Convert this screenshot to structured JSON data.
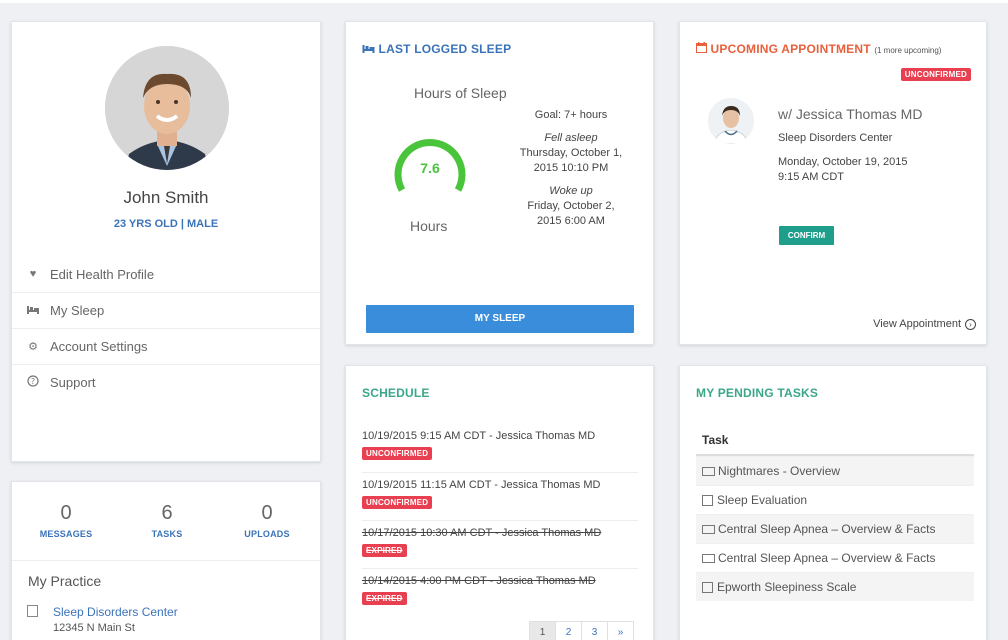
{
  "profile": {
    "name": "John Smith",
    "meta": "23 YRS OLD | MALE",
    "menu": [
      "Edit Health Profile",
      "My Sleep",
      "Account Settings",
      "Support"
    ]
  },
  "stats": [
    {
      "num": "0",
      "label": "MESSAGES"
    },
    {
      "num": "6",
      "label": "TASKS"
    },
    {
      "num": "0",
      "label": "UPLOADS"
    }
  ],
  "practice": {
    "title": "My Practice",
    "name": "Sleep Disorders Center",
    "address": "12345 N Main St"
  },
  "last_sleep": {
    "title": "LAST LOGGED SLEEP",
    "hours_title": "Hours of Sleep",
    "value": "7.6",
    "value_num": 7.6,
    "unit": "Hours",
    "goal": "Goal: 7+ hours",
    "fell_label": "Fell asleep",
    "fell_date": "Thursday, October 1,",
    "fell_time": "2015 10:10 PM",
    "woke_label": "Woke up",
    "woke_date": "Friday, October 2,",
    "woke_time": "2015 6:00 AM",
    "button": "MY SLEEP"
  },
  "appointment": {
    "title": "UPCOMING APPOINTMENT",
    "more": "(1 more upcoming)",
    "status": "UNCONFIRMED",
    "with": "w/ Jessica Thomas MD",
    "center": "Sleep Disorders Center",
    "date": "Monday, October 19, 2015",
    "time": "9:15 AM CDT",
    "confirm": "CONFIRM",
    "view": "View Appointment"
  },
  "schedule": {
    "title": "SCHEDULE",
    "rows": [
      {
        "text": "10/19/2015 9:15 AM CDT - Jessica Thomas MD",
        "badge": "UNCONFIRMED"
      },
      {
        "text": "10/19/2015 11:15 AM CDT - Jessica Thomas MD",
        "badge": "UNCONFIRMED"
      },
      {
        "text": "10/17/2015 10:30 AM CDT - Jessica Thomas MD",
        "badge": "EXPIRED"
      },
      {
        "text": "10/14/2015 4:00 PM CDT - Jessica Thomas MD",
        "badge": "EXPIRED"
      }
    ],
    "pages": [
      "1",
      "2",
      "3",
      "»"
    ]
  },
  "tasks": {
    "title": "MY PENDING TASKS",
    "header": "Task",
    "rows": [
      "Nightmares - Overview",
      "Sleep Evaluation",
      "Central Sleep Apnea – Overview & Facts",
      "Central Sleep Apnea – Overview & Facts",
      "Epworth Sleepiness Scale"
    ]
  },
  "colors": {
    "blue_accent": "#3b73b9",
    "green_accent": "#3aa789",
    "orange_accent": "#e8603c",
    "badge_red": "#e84050",
    "gauge_green": "#49c43b"
  }
}
